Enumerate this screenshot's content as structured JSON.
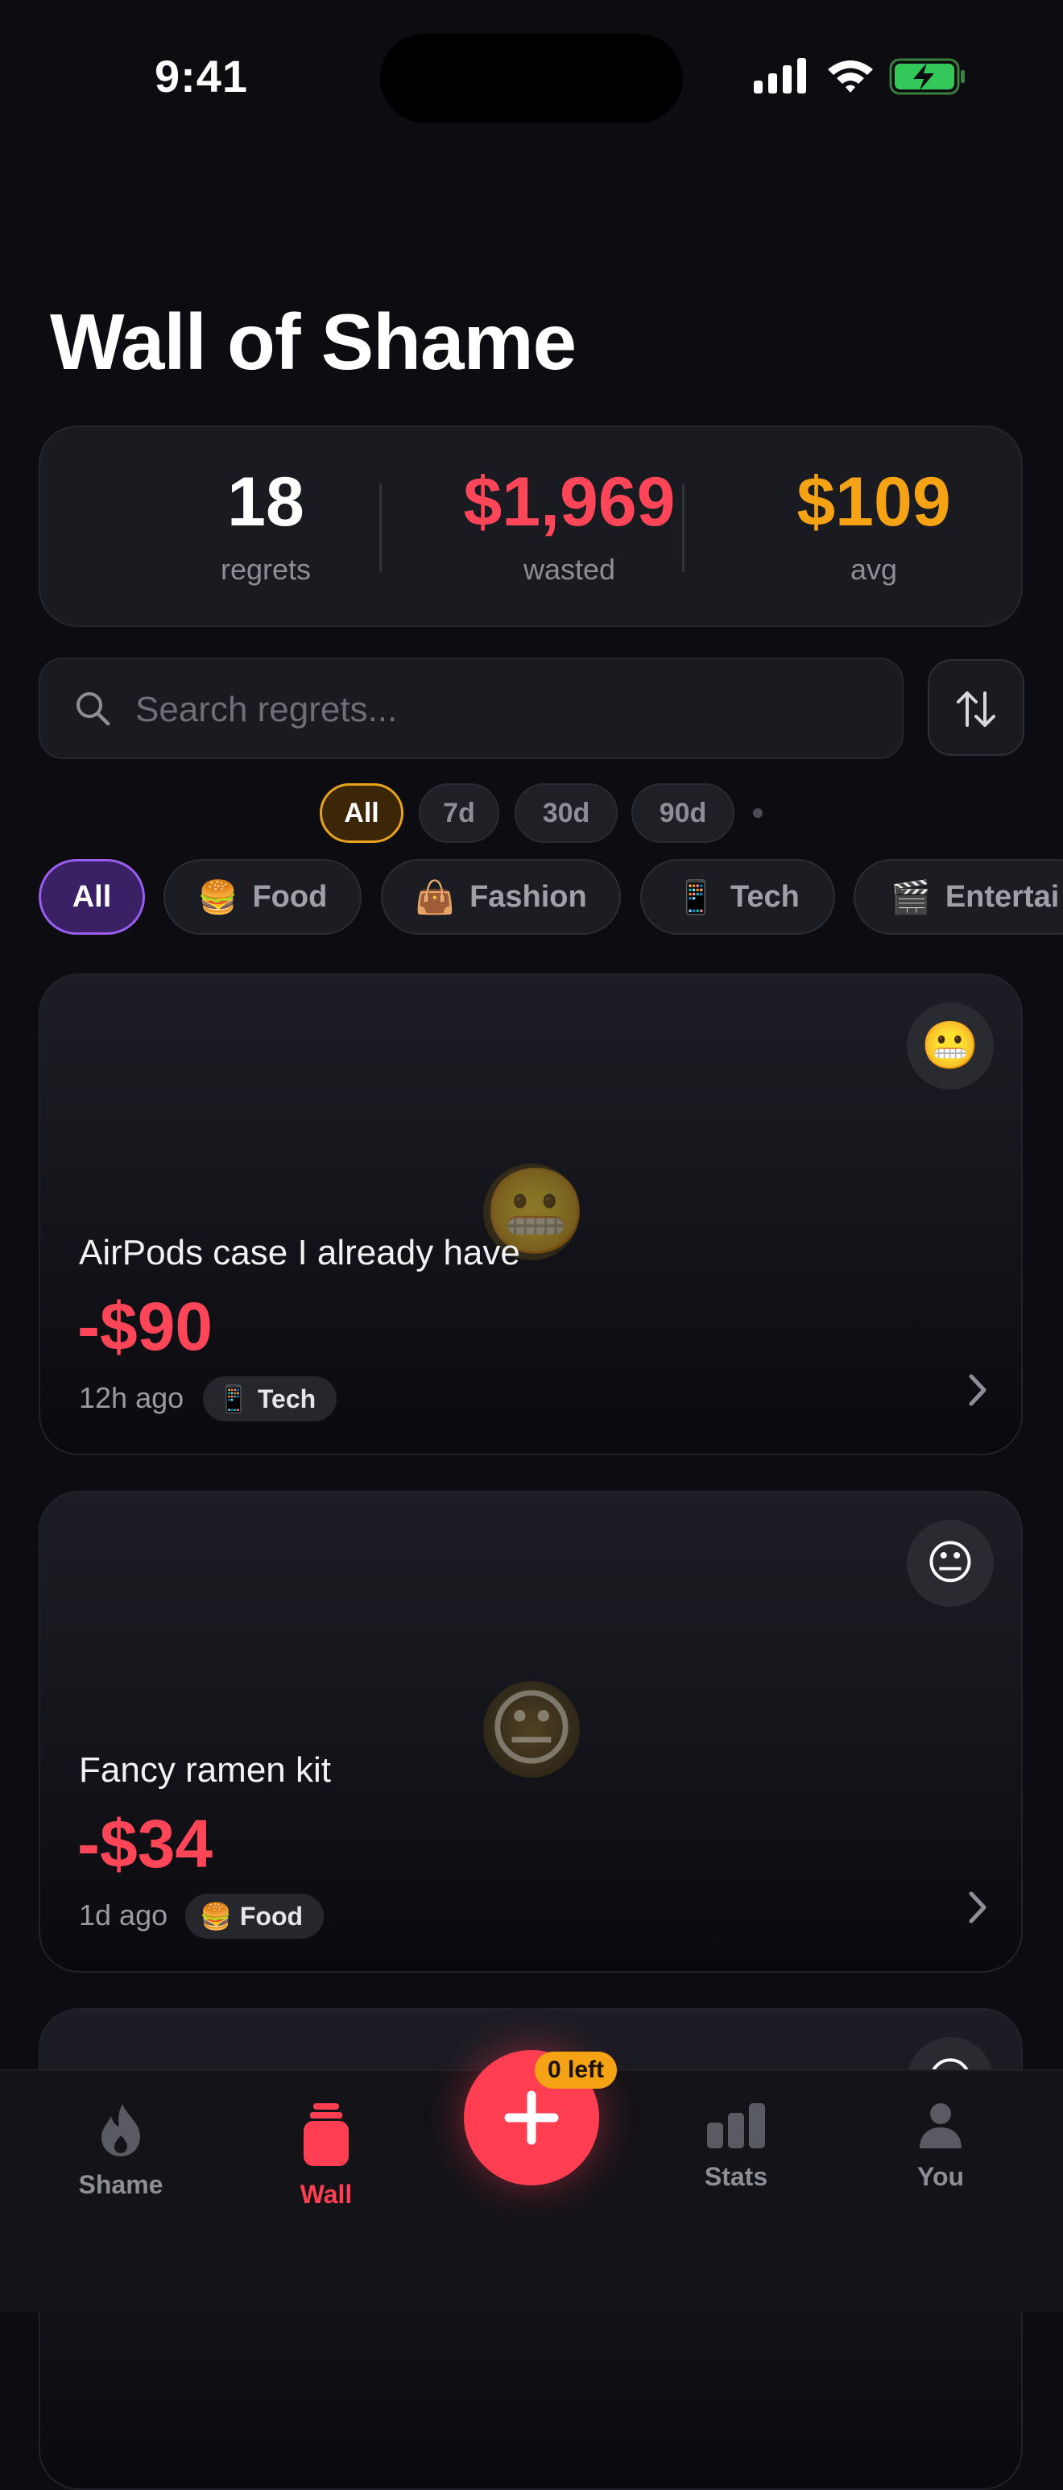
{
  "status_bar": {
    "time": "9:41"
  },
  "title": "Wall of Shame",
  "stats": [
    {
      "value": "18",
      "label": "regrets",
      "color": "#ffffff"
    },
    {
      "value": "$1,969",
      "label": "wasted",
      "color": "#ff4658"
    },
    {
      "value": "$109",
      "label": "avg",
      "color": "#f5a214"
    }
  ],
  "search": {
    "placeholder": "Search regrets..."
  },
  "time_filters": [
    {
      "label": "All",
      "active": true
    },
    {
      "label": "7d",
      "active": false
    },
    {
      "label": "30d",
      "active": false
    },
    {
      "label": "90d",
      "active": false
    }
  ],
  "categories": [
    {
      "emoji": "",
      "label": "All",
      "active": true
    },
    {
      "emoji": "🍔",
      "label": "Food",
      "active": false
    },
    {
      "emoji": "👜",
      "label": "Fashion",
      "active": false
    },
    {
      "emoji": "📱",
      "label": "Tech",
      "active": false
    },
    {
      "emoji": "🎬",
      "label": "Entertai",
      "active": false
    }
  ],
  "regrets": [
    {
      "emoji": "😬",
      "title": "AirPods case I already have",
      "amount": "-$90",
      "ago": "12h ago",
      "tag_emoji": "📱",
      "tag": "Tech"
    },
    {
      "emoji": "😐",
      "title": "Fancy ramen kit",
      "amount": "-$34",
      "ago": "1d ago",
      "tag_emoji": "🍔",
      "tag": "Food"
    },
    {
      "emoji": "😐"
    }
  ],
  "tab_bar": {
    "items": [
      {
        "label": "Shame",
        "icon": "flame-icon",
        "active": false
      },
      {
        "label": "Wall",
        "icon": "jar-icon",
        "active": true
      },
      {
        "label": "Stats",
        "icon": "bar-chart-icon",
        "active": false
      },
      {
        "label": "You",
        "icon": "person-icon",
        "active": false
      }
    ],
    "add_badge": "0 left"
  },
  "colors": {
    "accent_red": "#ff3e52",
    "accent_amber": "#f5a214",
    "accent_purple": "#9b5cf0"
  }
}
